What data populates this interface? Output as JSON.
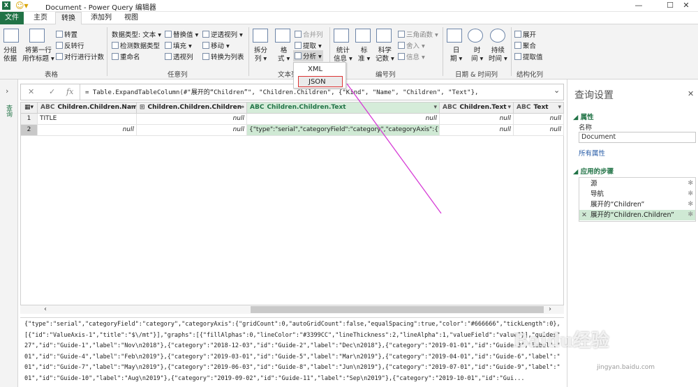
{
  "window": {
    "app_icon": "X",
    "title": "Document - Power Query 编辑器",
    "min": "—",
    "max": "☐",
    "close": "✕"
  },
  "tabs": [
    "文件",
    "主页",
    "转换",
    "添加列",
    "视图"
  ],
  "ribbon": {
    "table": {
      "group": "表格",
      "group_by": "分组\n依据",
      "first_row": "将第一行\n用作标题 ▾",
      "transpose": "转置",
      "reverse": "反转行",
      "count_rows": "对行进行计数"
    },
    "any_col": {
      "group": "任意列",
      "data_type": "数据类型: 文本 ▾",
      "detect": "检测数据类型",
      "rename": "重命名",
      "replace": "替换值 ▾",
      "fill": "填充 ▾",
      "pivot": "透视列",
      "unpivot": "逆透视列 ▾",
      "move": "移动 ▾",
      "to_list": "转换为列表"
    },
    "text": {
      "group": "文本列",
      "split": "拆分\n列 ▾",
      "format": "格\n式 ▾",
      "merge": "合并列",
      "extract": "提取 ▾",
      "parse": "分析 ▾"
    },
    "number": {
      "group": "编号列",
      "stats": "统计\n信息 ▾",
      "standard": "标\n准 ▾",
      "scientific": "科学\n记数 ▾",
      "trig": "三角函数 ▾",
      "round": "舍入 ▾",
      "info": "信息 ▾"
    },
    "datetime": {
      "group": "日期 & 时间列",
      "date": "日\n期 ▾",
      "time": "时\n间 ▾",
      "duration": "持续\n时间 ▾"
    },
    "structured": {
      "group": "结构化列",
      "expand": "展开",
      "aggregate": "聚合",
      "extract_values": "提取值"
    }
  },
  "parse_menu": {
    "xml": "XML",
    "json": "JSON"
  },
  "left_pane_label": "查询",
  "formula": {
    "cancel": "✕",
    "commit": "✓",
    "fx": "fx",
    "text": "= Table.ExpandTableColumn(#\"展开的“Children”\", \"Children.Children\", {\"Kind\", \"Name\", \"Children\", \"Text\"},",
    "expand": "⌄"
  },
  "columns": [
    {
      "type": "ABC",
      "name": "Children.Children.Name"
    },
    {
      "type": "⊞",
      "name": "Children.Children.Children"
    },
    {
      "type": "ABC",
      "name": "Children.Children.Text"
    },
    {
      "type": "ABC",
      "name": "Children.Text"
    },
    {
      "type": "ABC",
      "name": "Text"
    }
  ],
  "rows": [
    {
      "n": "1",
      "cells": [
        "TITLE",
        "null",
        "null",
        "null",
        "null"
      ]
    },
    {
      "n": "2",
      "cells": [
        "null",
        "null",
        "{\"type\":\"serial\",\"categoryField\":\"category\",\"categoryAxis\":{\"gridCount...",
        "null",
        "null"
      ]
    }
  ],
  "preview_lines": [
    "{\"type\":\"serial\",\"categoryField\":\"category\",\"categoryAxis\":{\"gridCount\":0,\"autoGridCount\":false,\"equalSpacing\":true,\"color\":\"#666666\",\"tickLength\":0},\"valueAxes\":",
    "[{\"id\":\"ValueAxis-1\",\"title\":\"$\\/mt\"}],\"graphs\":[{\"fillAlphas\":0,\"lineColor\":\"#3399CC\",\"lineThickness\":2,\"lineAlpha\":1,\"valueField\":\"value\"}],\"guides\":[{\"category\":\"2018-11-",
    "27\",\"id\":\"Guide-1\",\"label\":\"Nov\\n2018\"},{\"category\":\"2018-12-03\",\"id\":\"Guide-2\",\"label\":\"Dec\\n2018\"},{\"category\":\"2019-01-01\",\"id\":\"Guide-3\",\"label\":\"Jan\\n2019\"},{\"category\":\"2019-02-",
    "01\",\"id\":\"Guide-4\",\"label\":\"Feb\\n2019\"},{\"category\":\"2019-03-01\",\"id\":\"Guide-5\",\"label\":\"Mar\\n2019\"},{\"category\":\"2019-04-01\",\"id\":\"Guide-6\",\"label\":\"Apr\\n2019\"},{\"category\":\"2019-05-",
    "01\",\"id\":\"Guide-7\",\"label\":\"May\\n2019\"},{\"category\":\"2019-06-03\",\"id\":\"Guide-8\",\"label\":\"Jun\\n2019\"},{\"category\":\"2019-07-01\",\"id\":\"Guide-9\",\"label\":\"Jul\\n2019\"},{\"category\":\"2019-08-",
    "01\",\"id\":\"Guide-10\",\"label\":\"Aug\\n2019\"},{\"category\":\"2019-09-02\",\"id\":\"Guide-11\",\"label\":\"Sep\\n2019\"},{\"category\":\"2019-10-01\",\"id\":\"Gui..."
  ],
  "query_settings": {
    "title": "查询设置",
    "props_header": "属性",
    "name_label": "名称",
    "name_value": "Document",
    "all_props": "所有属性",
    "steps_header": "应用的步骤",
    "steps": [
      "源",
      "导航",
      "展开的“Children”",
      "展开的“Children.Children”"
    ]
  },
  "watermark": {
    "brand": "Baidu经验",
    "url": "jingyan.baidu.com"
  },
  "colors": {
    "excel_green": "#217346",
    "highlight": "#cfe9d4",
    "annotation_line": "#d63cd6",
    "annotation_box": "#dd3333"
  }
}
